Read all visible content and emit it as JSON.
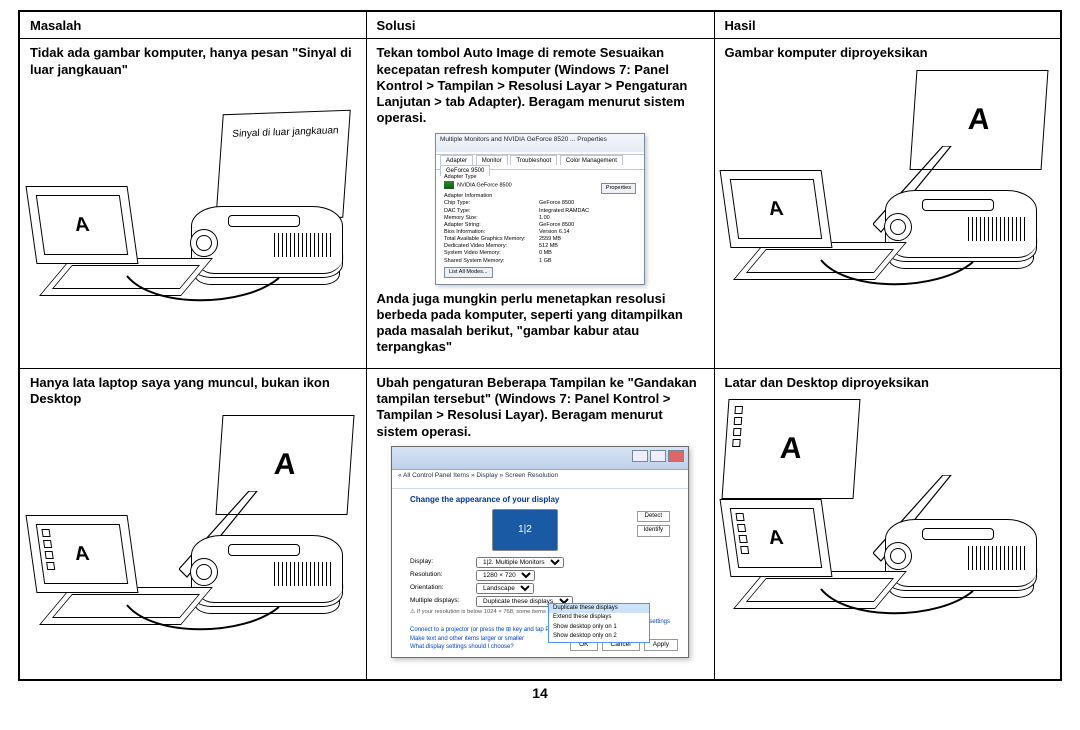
{
  "headers": {
    "c1": "Masalah",
    "c2": "Solusi",
    "c3": "Hasil"
  },
  "row1": {
    "problem_bold": "Tidak ada gambar komputer, hanya pesan \"Sinyal di luar jangkauan\"",
    "bubble": "Sinyal di luar jangkauan",
    "screen_letter": "A",
    "solution_bold": "Tekan tombol Auto Image di remote Sesuaikan kecepatan refresh komputer (Windows 7: Panel Kontrol > Tampilan > Resolusi Layar > Pengaturan Lanjutan > tab Adapter). Beragam menurut sistem operasi.",
    "adapter": {
      "title": "Multiple Monitors and NVIDIA GeForce 8520 ... Properties",
      "tabs": [
        "Adapter",
        "Monitor",
        "Troubleshoot",
        "Color Management",
        "GeForce 9500"
      ],
      "type_label": "Adapter Type",
      "type_value": "NVIDIA GeForce 8500",
      "prop_btn": "Properties",
      "info_label": "Adapter Information",
      "kv": [
        {
          "k": "Chip Type:",
          "v": "GeForce 8500"
        },
        {
          "k": "DAC Type:",
          "v": "Integrated RAMDAC"
        },
        {
          "k": "Memory Size:",
          "v": "1.00"
        },
        {
          "k": "Adapter String:",
          "v": "GeForce 8500"
        },
        {
          "k": "Bios Information:",
          "v": "Version 6.14"
        },
        {
          "k": "Total Available Graphics Memory:",
          "v": "2559 MB"
        },
        {
          "k": "Dedicated Video Memory:",
          "v": "512 MB"
        },
        {
          "k": "System Video Memory:",
          "v": "0 MB"
        },
        {
          "k": "Shared System Memory:",
          "v": "1 GB"
        }
      ],
      "list_btn": "List All Modes..."
    },
    "solution_tail_bold": "Anda juga mungkin perlu menetapkan resolusi berbeda pada komputer, seperti yang ditampilkan pada masalah berikut, \"gambar kabur atau terpangkas\"",
    "result_bold": "Gambar komputer diproyeksikan",
    "result_letter_big": "A",
    "result_letter_small": "A"
  },
  "row2": {
    "problem_bold": "Hanya lata laptop saya yang muncul, bukan ikon Desktop",
    "big_letter": "A",
    "small_letter": "A",
    "solution_bold": "Ubah pengaturan Beberapa Tampilan ke \"Gandakan tampilan tersebut\" (Windows 7: Panel Kontrol > Tampilan > Resolusi Layar). Beragam menurut sistem operasi.",
    "resdlg": {
      "path": "« All Control Panel Items  »  Display  »  Screen Resolution",
      "heading": "Change the appearance of your display",
      "detect": "Detect",
      "identify": "Identify",
      "display_lbl": "Display:",
      "display_val": "1|2. Multiple Monitors",
      "resolution_lbl": "Resolution:",
      "resolution_val": "1280 × 720",
      "orientation_lbl": "Orientation:",
      "orientation_val": "Landscape",
      "multi_lbl": "Multiple displays:",
      "multi_val": "Duplicate these displays",
      "multi_opts": [
        "Duplicate these displays",
        "Extend these displays",
        "Show desktop only on 1",
        "Show desktop only on 2"
      ],
      "warn": "⚠ If your resolution is below 1024 × 768, some items may not fit on the screen.",
      "adv_link": "Advanced settings",
      "link1": "Connect to a projector  (or press the ⊞ key and tap P)",
      "link2": "Make text and other items larger or smaller",
      "link3": "What display settings should I choose?",
      "ok": "OK",
      "cancel": "Cancel",
      "apply": "Apply"
    },
    "result_bold": "Latar dan Desktop diproyeksikan",
    "result_letter_big": "A",
    "result_letter_small": "A"
  },
  "page_number": "14"
}
